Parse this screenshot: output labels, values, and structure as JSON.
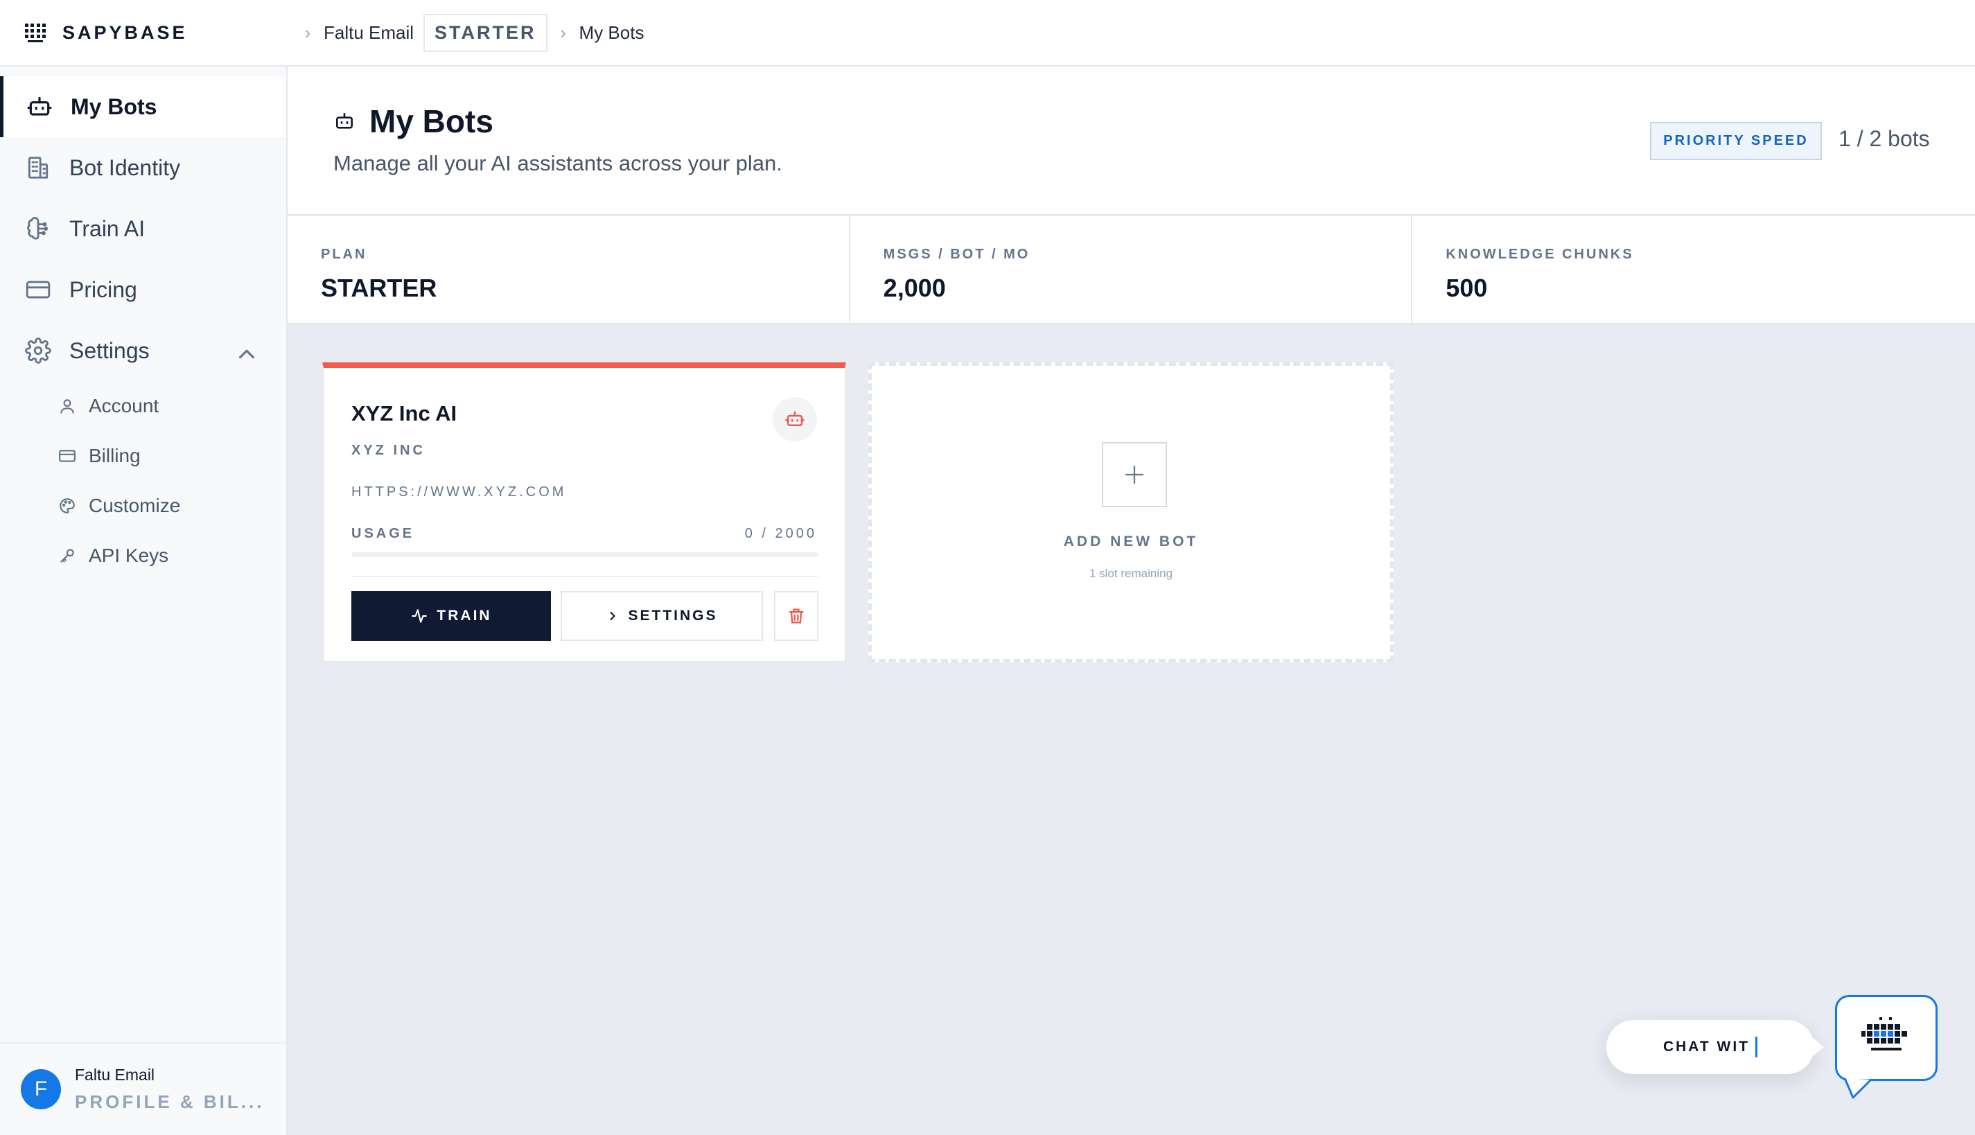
{
  "brand": {
    "name": "SAPYBASE",
    "icon": "sapybase-logo-icon"
  },
  "breadcrumb": {
    "account": "Faltu Email",
    "plan_badge": "STARTER",
    "page": "My Bots"
  },
  "sidebar": {
    "items": [
      {
        "label": "My Bots",
        "icon": "bot-icon",
        "active": true
      },
      {
        "label": "Bot Identity",
        "icon": "building-icon"
      },
      {
        "label": "Train AI",
        "icon": "brain-icon"
      },
      {
        "label": "Pricing",
        "icon": "credit-card-icon"
      },
      {
        "label": "Settings",
        "icon": "gear-icon",
        "expanded": true
      }
    ],
    "settings_children": [
      {
        "label": "Account",
        "icon": "user-icon"
      },
      {
        "label": "Billing",
        "icon": "card-icon"
      },
      {
        "label": "Customize",
        "icon": "palette-icon"
      },
      {
        "label": "API Keys",
        "icon": "key-icon"
      }
    ],
    "user": {
      "initial": "F",
      "name": "Faltu Email",
      "subtitle": "PROFILE & BIL..."
    }
  },
  "header": {
    "title": "My Bots",
    "description": "Manage all your AI assistants across your plan.",
    "priority_badge": "PRIORITY SPEED",
    "bot_count": "1 / 2 bots"
  },
  "stats": [
    {
      "label": "PLAN",
      "value": "STARTER"
    },
    {
      "label": "MSGS / BOT / MO",
      "value": "2,000"
    },
    {
      "label": "KNOWLEDGE CHUNKS",
      "value": "500"
    }
  ],
  "bots": [
    {
      "name": "XYZ Inc AI",
      "org": "XYZ INC",
      "url": "HTTPS://WWW.XYZ.COM",
      "usage_label": "USAGE",
      "usage_text": "0 / 2000",
      "usage_fraction": 0,
      "accent_color": "#ef5a4c",
      "train_label": "TRAIN",
      "settings_label": "SETTINGS"
    }
  ],
  "add_bot": {
    "label": "ADD NEW BOT",
    "sub": "1 slot remaining"
  },
  "chat_widget": {
    "label": "CHAT WIT"
  },
  "colors": {
    "primary": "#101a33",
    "accent_red": "#ef5a4c",
    "link_blue": "#1478e6"
  }
}
